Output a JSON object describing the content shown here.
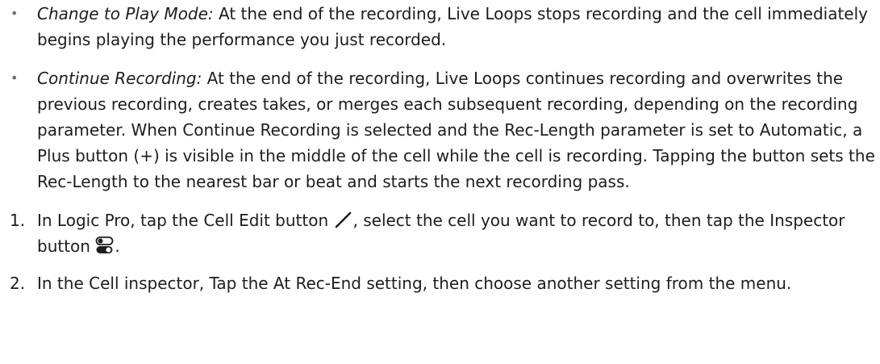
{
  "bullets": [
    {
      "marker": "•",
      "term": "Change to Play Mode:",
      "text": " At the end of the recording, Live Loops stops recording and the cell immediately begins playing the performance you just recorded."
    },
    {
      "marker": "•",
      "term": "Continue Recording:",
      "text": " At the end of the recording, Live Loops continues recording and overwrites the previous recording, creates takes, or merges each subsequent recording, depending on the recording parameter. When Continue Recording is selected and the Rec-Length parameter is set to Automatic, a Plus button (+) is visible in the middle of the cell while the cell is recording. Tapping the button sets the Rec-Length to the nearest bar or beat and starts the next recording pass."
    }
  ],
  "steps": [
    {
      "number": "1.",
      "text_before": "In Logic Pro, tap the Cell Edit button ",
      "icon1": "pencil-icon",
      "text_middle": ", select the cell you want to record to, then tap the Inspector button ",
      "icon2": "inspector-toggle-icon",
      "text_after": "."
    },
    {
      "number": "2.",
      "text": "In the Cell inspector, Tap the At Rec-End setting, then choose another setting from the menu."
    }
  ]
}
